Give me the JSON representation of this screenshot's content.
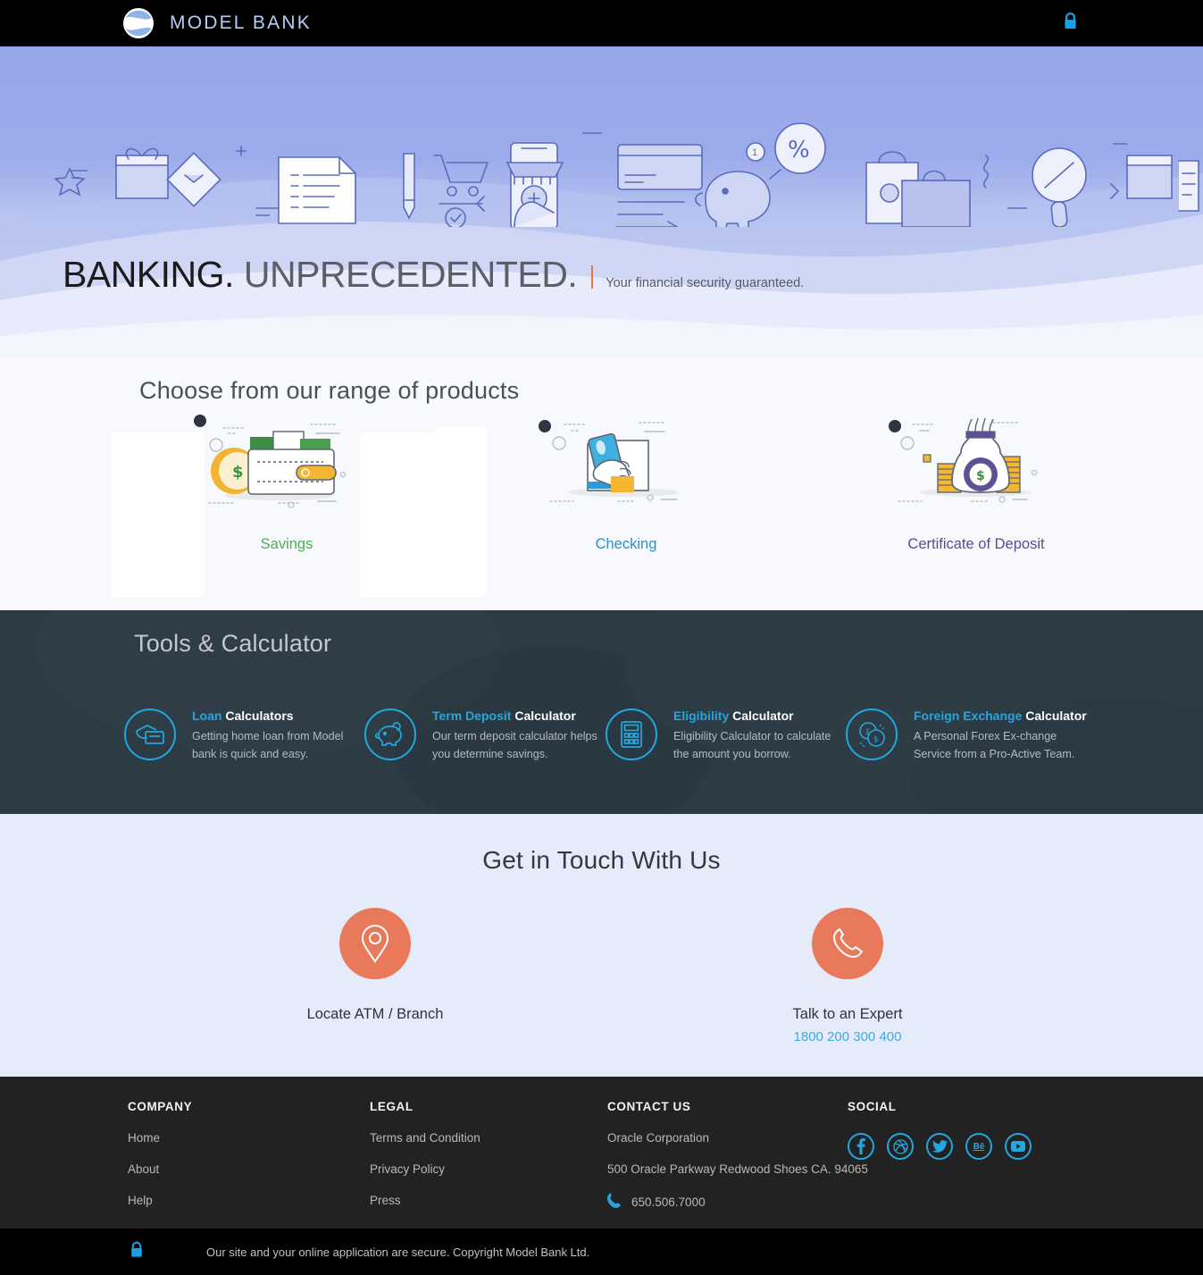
{
  "nav": {
    "brand": "MODEL BANK",
    "logo_icon": "model-bank-logo",
    "lock_icon": "lock-icon",
    "lock_color": "#18a0e8"
  },
  "hero": {
    "headline_strong": "BANKING.",
    "headline_light": "UNPRECEDENTED.",
    "divider_color": "#e8744a",
    "tagline": "Your financial security guaranteed.",
    "background_color": "#97a6ea",
    "illustration": "e-commerce-banking-line-art-strip"
  },
  "products": {
    "title": "Choose from our range of products",
    "background_color": "#f7f9fc",
    "items": [
      {
        "label": "Savings",
        "color": "#4caf50",
        "art": "wallet-with-coin-illustration"
      },
      {
        "label": "Checking",
        "color": "#2a8fd0",
        "art": "hand-holding-card-illustration"
      },
      {
        "label": "Certificate of Deposit",
        "color": "#5b4a9c",
        "art": "money-bag-with-coins-illustration"
      }
    ]
  },
  "tools": {
    "title": "Tools & Calculator",
    "accent_color": "#22a7e0",
    "background_color": "#2c3b44",
    "items": [
      {
        "title_accent": "Loan",
        "title_rest": " Calculators",
        "desc": "Getting home loan from Model bank is quick and easy.",
        "icon": "hand-card-swipe-icon"
      },
      {
        "title_accent": "Term Deposit",
        "title_rest": " Calculator",
        "desc": "Our term deposit calculator helps you determine savings.",
        "icon": "piggy-bank-icon"
      },
      {
        "title_accent": "Eligibility",
        "title_rest": " Calculator",
        "desc": "Eligibility Calculator to calculate the amount you borrow.",
        "icon": "calculator-icon"
      },
      {
        "title_accent": "Foreign Exchange",
        "title_rest": " Calculator",
        "desc": "A Personal Forex Ex-change Service from a Pro-Active Team.",
        "icon": "currency-coins-icon"
      }
    ]
  },
  "touch": {
    "title": "Get in Touch With Us",
    "circle_color": "#e8795a",
    "items": [
      {
        "label": "Locate ATM / Branch",
        "icon": "map-pin-icon",
        "phone": ""
      },
      {
        "label": "Talk to an Expert",
        "icon": "phone-icon",
        "phone": "1800 200 300 400"
      }
    ]
  },
  "footer": {
    "company": {
      "head": "COMPANY",
      "links": [
        "Home",
        "About",
        "Help"
      ]
    },
    "legal": {
      "head": "LEGAL",
      "links": [
        "Terms and Condition",
        "Privacy Policy",
        "Press"
      ]
    },
    "contact": {
      "head": "CONTACT US",
      "org": "Oracle Corporation",
      "address": "500 Oracle Parkway Redwood Shoes CA. 94065",
      "phone": "650.506.7000",
      "phone_icon": "phone-icon"
    },
    "social": {
      "head": "SOCIAL",
      "icons": [
        "facebook-icon",
        "dribbble-icon",
        "twitter-icon",
        "behance-icon",
        "youtube-icon"
      ],
      "glyphs": [
        "f",
        "ⓓ",
        "✉",
        "Bē",
        "▶"
      ],
      "color": "#22a7e0"
    },
    "bottom": {
      "lock_icon": "lock-icon",
      "text": "Our site and your online application are secure. Copyright Model Bank Ltd."
    }
  }
}
